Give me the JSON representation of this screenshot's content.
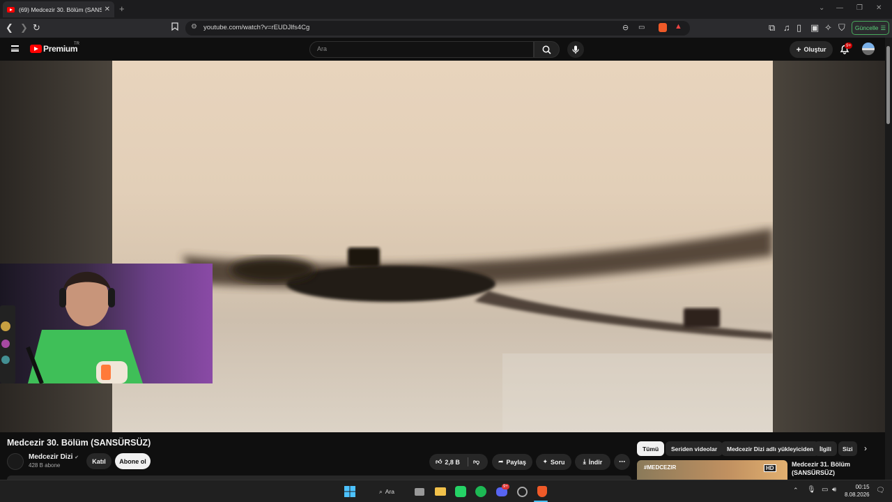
{
  "browser": {
    "tab_title": "(69) Medcezir 30. Bölüm (SANSÜ",
    "url": "youtube.com/watch?v=rEUDJlfs4Cg",
    "update_label": "Güncelle"
  },
  "youtube": {
    "logo_text": "Premium",
    "region": "TR",
    "search_placeholder": "Ara",
    "create_label": "Oluştur",
    "notif_count": "9+"
  },
  "video": {
    "title": "Medcezir 30. Bölüm (SANSÜRSÜZ)",
    "channel_name": "Medcezir Dizi",
    "subscribers": "428 B abone",
    "join_label": "Katıl",
    "subscribe_label": "Abone ol",
    "like_count": "2,8 B",
    "share_label": "Paylaş",
    "ask_label": "Soru",
    "download_label": "İndir"
  },
  "chips": [
    "Tümü",
    "Seriden videolar",
    "Medcezir Dizi adlı yükleyiciden",
    "İlgili",
    "Sizi"
  ],
  "recommendation": {
    "title": "Medcezir 31. Bölüm (SANSÜRSÜZ)",
    "badge": "HD",
    "thumb_text": "#MEDCEZIR"
  },
  "taskbar": {
    "search_label": "Ara",
    "time": "00:15",
    "date": "8.08.2026",
    "discord_badge": "9+"
  }
}
